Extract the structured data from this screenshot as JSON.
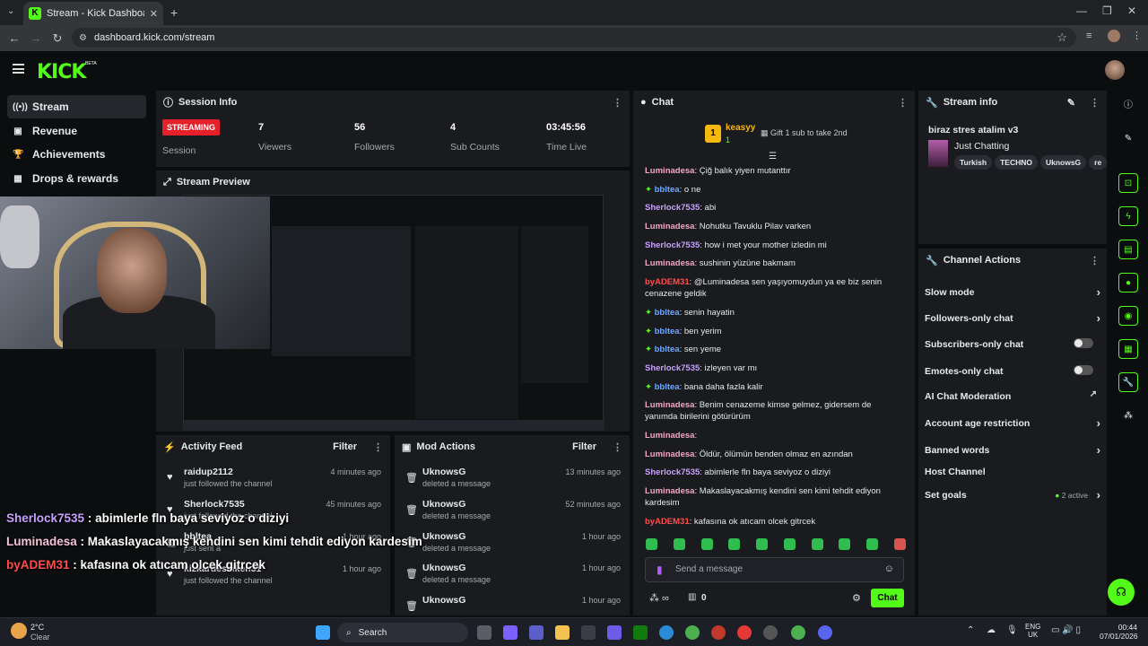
{
  "browser": {
    "tab_title": "Stream - Kick Dashboard",
    "url": "dashboard.kick.com/stream"
  },
  "brand": {
    "logo": "KICK",
    "beta": "BETA",
    "accent": "#53fc18"
  },
  "sidebar": {
    "items": [
      {
        "label": "Stream",
        "icon": "broadcast-icon"
      },
      {
        "label": "Revenue",
        "icon": "revenue-icon"
      },
      {
        "label": "Achievements",
        "icon": "trophy-icon"
      },
      {
        "label": "Drops & rewards",
        "icon": "gift-icon"
      }
    ]
  },
  "session": {
    "title": "Session Info",
    "status": "STREAMING",
    "status_label": "Session",
    "stats": [
      {
        "value": "7",
        "label": "Viewers"
      },
      {
        "value": "56",
        "label": "Followers"
      },
      {
        "value": "4",
        "label": "Sub Counts"
      },
      {
        "value": "03:45:56",
        "label": "Time Live"
      }
    ]
  },
  "preview": {
    "title": "Stream Preview"
  },
  "activity": {
    "title": "Activity Feed",
    "filter": "Filter",
    "items": [
      {
        "name": "raidup2112",
        "sub": "just followed the channel",
        "time": "4 minutes ago"
      },
      {
        "name": "Sherlock7535",
        "sub": "just followed the channel",
        "time": "45 minutes ago"
      },
      {
        "name": "bbltea",
        "sub": "just sent a",
        "time": "1 hour ago"
      },
      {
        "name": "kizkardessiken31",
        "sub": "just followed the channel",
        "time": "1 hour ago"
      }
    ]
  },
  "mod": {
    "title": "Mod Actions",
    "filter": "Filter",
    "items": [
      {
        "name": "UknowsG",
        "sub": "deleted a message",
        "time": "13 minutes ago"
      },
      {
        "name": "UknowsG",
        "sub": "deleted a message",
        "time": "52 minutes ago"
      },
      {
        "name": "UknowsG",
        "sub": "deleted a message",
        "time": "1 hour ago"
      },
      {
        "name": "UknowsG",
        "sub": "deleted a message",
        "time": "1 hour ago"
      },
      {
        "name": "UknowsG",
        "sub": "",
        "time": "1 hour ago"
      }
    ]
  },
  "chat": {
    "title": "Chat",
    "top_gifter": "keasyy",
    "top_gifter_count": "1",
    "gift_text": "Gift 1 sub to take 2nd",
    "placeholder": "Send a message",
    "send": "Chat",
    "bottom_count": "0",
    "messages": [
      {
        "user": "Luminadesa",
        "color": "#f4a7c4",
        "text": "Çiğ balık yiyen mutanttır"
      },
      {
        "user": "bbltea",
        "color": "#6fa8ff",
        "text": "o ne"
      },
      {
        "user": "Sherlock7535",
        "color": "#c9a0ff",
        "text": "abi"
      },
      {
        "user": "Luminadesa",
        "color": "#f4a7c4",
        "text": "Nohutku Tavuklu Pilav varken"
      },
      {
        "user": "Sherlock7535",
        "color": "#c9a0ff",
        "text": "how i met your mother izledin mi"
      },
      {
        "user": "Luminadesa",
        "color": "#f4a7c4",
        "text": "sushinin yüzüne bakmam"
      },
      {
        "user": "byADEM31",
        "color": "#ff4d4d",
        "text": "@Luminadesa sen yaşıyomuydun ya ee biz senin cenazene geldik"
      },
      {
        "user": "bbltea",
        "color": "#6fa8ff",
        "text": "senin hayatin"
      },
      {
        "user": "bbltea",
        "color": "#6fa8ff",
        "text": "ben yerim"
      },
      {
        "user": "bbltea",
        "color": "#6fa8ff",
        "text": "sen yeme"
      },
      {
        "user": "Sherlock7535",
        "color": "#c9a0ff",
        "text": "izleyen var mı"
      },
      {
        "user": "bbltea",
        "color": "#6fa8ff",
        "text": "bana daha fazla kalir"
      },
      {
        "user": "Luminadesa",
        "color": "#f4a7c4",
        "text": "Benim cenazeme kimse gelmez, gidersem de yanımda birilerini götürürüm"
      },
      {
        "user": "Luminadesa",
        "color": "#f4a7c4",
        "text": ""
      },
      {
        "user": "Luminadesa",
        "color": "#f4a7c4",
        "text": "Öldür, ölümün benden olmaz en azından"
      },
      {
        "user": "Sherlock7535",
        "color": "#c9a0ff",
        "text": "abimlerle fln baya seviyoz o diziyi"
      },
      {
        "user": "Luminadesa",
        "color": "#f4a7c4",
        "text": "Makaslayacakmış kendini sen kimi tehdit ediyon kardesim"
      },
      {
        "user": "byADEM31",
        "color": "#ff4d4d",
        "text": "kafasına ok atıcam olcek gitrcek"
      }
    ]
  },
  "stream_info": {
    "title": "Stream info",
    "stream_title": "biraz stres atalim v3",
    "category": "Just Chatting",
    "tags": [
      "Turkish",
      "TECHNO",
      "UknowsG",
      "re"
    ]
  },
  "channel_actions": {
    "title": "Channel Actions",
    "items": [
      {
        "label": "Slow mode",
        "type": "arrow"
      },
      {
        "label": "Followers-only chat",
        "type": "arrow"
      },
      {
        "label": "Subscribers-only chat",
        "type": "toggle"
      },
      {
        "label": "Emotes-only chat",
        "type": "toggle"
      },
      {
        "label": "AI Chat Moderation",
        "type": "external"
      },
      {
        "label": "Account age restriction",
        "type": "arrow"
      },
      {
        "label": "Banned words",
        "type": "arrow"
      },
      {
        "label": "Host Channel",
        "type": "none"
      },
      {
        "label": "Set goals",
        "type": "arrow",
        "badge": "2 active"
      }
    ]
  },
  "overlay": {
    "lines": [
      {
        "user": "Sherlock7535",
        "color": "#c9a0ff",
        "text": "abimlerle fln baya seviyoz o diziyi"
      },
      {
        "user": "Luminadesa",
        "color": "#f4c2d6",
        "text": "Makaslayacakmış kendini sen kimi tehdit ediyon kardesim"
      },
      {
        "user": "byADEM31",
        "color": "#ff4d4d",
        "text": "kafasına ok atıcam olcek gitrcek"
      }
    ]
  },
  "taskbar": {
    "weather_temp": "2°C",
    "weather_desc": "Clear",
    "search": "Search",
    "lang1": "ENG",
    "lang2": "UK",
    "time": "00:44",
    "date": "07/01/2026"
  }
}
